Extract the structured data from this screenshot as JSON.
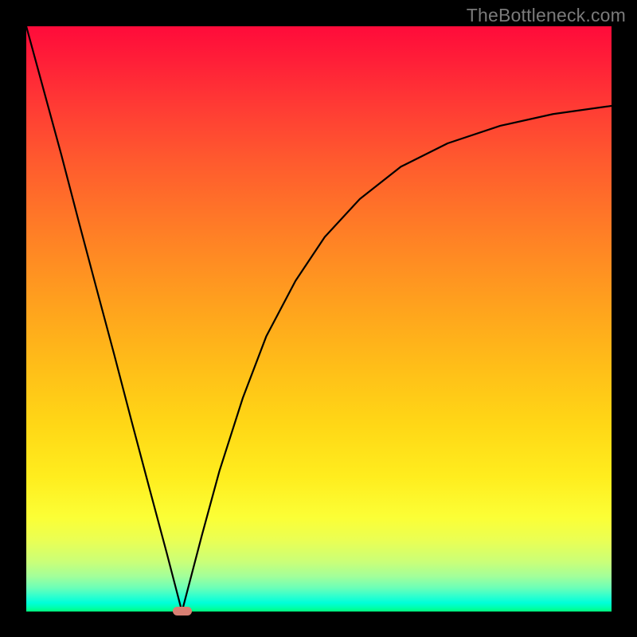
{
  "watermark": "TheBottleneck.com",
  "chart_data": {
    "type": "line",
    "title": "",
    "xlabel": "",
    "ylabel": "",
    "xlim": [
      0,
      1
    ],
    "ylim": [
      0,
      1
    ],
    "series": [
      {
        "name": "bottleneck-curve",
        "x": [
          0.0,
          0.03,
          0.06,
          0.09,
          0.12,
          0.15,
          0.18,
          0.21,
          0.24,
          0.266,
          0.3,
          0.33,
          0.37,
          0.41,
          0.46,
          0.51,
          0.57,
          0.64,
          0.72,
          0.81,
          0.9,
          1.0
        ],
        "values": [
          1.0,
          0.89,
          0.78,
          0.665,
          0.552,
          0.44,
          0.325,
          0.212,
          0.1,
          0.0,
          0.13,
          0.24,
          0.365,
          0.47,
          0.565,
          0.64,
          0.705,
          0.76,
          0.8,
          0.83,
          0.85,
          0.864
        ]
      }
    ],
    "minimum_marker": {
      "x": 0.266,
      "y": 0.0
    },
    "colors": {
      "curve": "#000000",
      "marker": "#d87f73",
      "frame": "#000000"
    }
  }
}
